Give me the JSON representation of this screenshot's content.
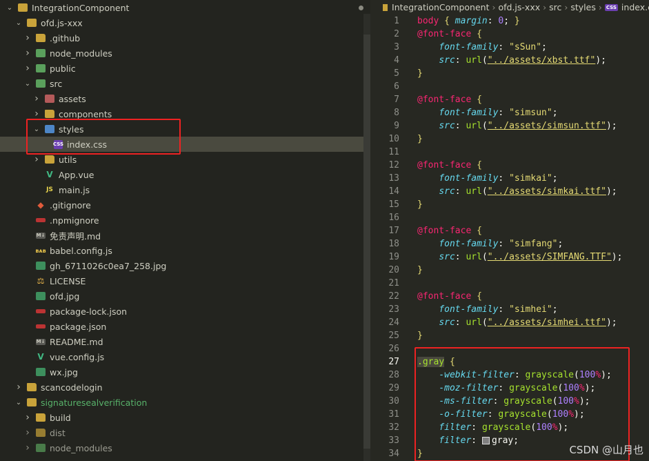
{
  "explorer": {
    "rows": [
      {
        "label": "IntegrationComponent",
        "chev": "v",
        "icon": "folder-open",
        "depth": 0,
        "dot": "#8a8a80"
      },
      {
        "label": "ofd.js-xxx",
        "chev": "v",
        "icon": "folder-open",
        "depth": 1
      },
      {
        "label": ".github",
        "chev": ">",
        "icon": "folder",
        "depth": 2
      },
      {
        "label": "node_modules",
        "chev": ">",
        "icon": "folder-green",
        "depth": 2
      },
      {
        "label": "public",
        "chev": ">",
        "icon": "folder-green",
        "depth": 2
      },
      {
        "label": "src",
        "chev": "v",
        "icon": "folder-green",
        "depth": 2
      },
      {
        "label": "assets",
        "chev": ">",
        "icon": "folder-red",
        "depth": 3
      },
      {
        "label": "components",
        "chev": ">",
        "icon": "folder",
        "depth": 3
      },
      {
        "label": "styles",
        "chev": "v",
        "icon": "folder-blue",
        "depth": 3
      },
      {
        "label": "index.css",
        "chev": "",
        "icon": "css",
        "depth": 4,
        "selected": true
      },
      {
        "label": "utils",
        "chev": ">",
        "icon": "folder",
        "depth": 3
      },
      {
        "label": "App.vue",
        "chev": "",
        "icon": "vue",
        "depth": 3
      },
      {
        "label": "main.js",
        "chev": "",
        "icon": "js",
        "depth": 3
      },
      {
        "label": ".gitignore",
        "chev": "",
        "icon": "git",
        "depth": 2
      },
      {
        "label": ".npmignore",
        "chev": "",
        "icon": "npm",
        "depth": 2
      },
      {
        "label": "免责声明.md",
        "chev": "",
        "icon": "md",
        "depth": 2
      },
      {
        "label": "babel.config.js",
        "chev": "",
        "icon": "babel",
        "depth": 2
      },
      {
        "label": "gh_6711026c0ea7_258.jpg",
        "chev": "",
        "icon": "img",
        "depth": 2
      },
      {
        "label": "LICENSE",
        "chev": "",
        "icon": "license",
        "depth": 2
      },
      {
        "label": "ofd.jpg",
        "chev": "",
        "icon": "img",
        "depth": 2
      },
      {
        "label": "package-lock.json",
        "chev": "",
        "icon": "json",
        "depth": 2
      },
      {
        "label": "package.json",
        "chev": "",
        "icon": "json",
        "depth": 2
      },
      {
        "label": "README.md",
        "chev": "",
        "icon": "md",
        "depth": 2
      },
      {
        "label": "vue.config.js",
        "chev": "",
        "icon": "vueconf",
        "depth": 2
      },
      {
        "label": "wx.jpg",
        "chev": "",
        "icon": "img",
        "depth": 2
      },
      {
        "label": "scancodelogin",
        "chev": ">",
        "icon": "folder",
        "depth": 1
      },
      {
        "label": "signaturesealverification",
        "chev": "v",
        "icon": "folder-open",
        "depth": 1,
        "green": true,
        "dot": "#3aa655"
      },
      {
        "label": "build",
        "chev": ">",
        "icon": "folder",
        "depth": 2
      },
      {
        "label": "dist",
        "chev": ">",
        "icon": "folder",
        "depth": 2,
        "dim": true
      },
      {
        "label": "node_modules",
        "chev": ">",
        "icon": "folder-green",
        "depth": 2,
        "dim": true
      }
    ]
  },
  "editor": {
    "breadcrumb": {
      "folder": "IntegrationComponent",
      "sub": "ofd.js-xxx",
      "src": "src",
      "styles": "styles",
      "file": "index.css",
      "file_icon": "CSS"
    },
    "lines": [
      {
        "n": "1",
        "html": "<span class='t-sel'>body</span> <span class='t-brace'>{</span> <span class='t-prop'>margin</span><span class='t-punc'>:</span> <span class='t-num'>0</span><span class='t-punc'>;</span> <span class='t-brace'>}</span>"
      },
      {
        "n": "2",
        "html": "<span class='t-at'>@font-face</span> <span class='t-brace'>{</span>"
      },
      {
        "n": "3",
        "html": "    <span class='t-prop'>font-family</span><span class='t-punc'>:</span> <span class='t-str'>\"sSun\"</span><span class='t-punc'>;</span>"
      },
      {
        "n": "4",
        "html": "    <span class='t-prop'>src</span><span class='t-punc'>:</span> <span class='t-fn'>url</span><span class='t-punc'>(</span><span class='t-url'>\"../assets/xbst.ttf\"</span><span class='t-punc'>);</span>"
      },
      {
        "n": "5",
        "html": "<span class='t-brace'>}</span>"
      },
      {
        "n": "6",
        "html": ""
      },
      {
        "n": "7",
        "html": "<span class='t-at'>@font-face</span> <span class='t-brace'>{</span>"
      },
      {
        "n": "8",
        "html": "    <span class='t-prop'>font-family</span><span class='t-punc'>:</span> <span class='t-str'>\"simsun\"</span><span class='t-punc'>;</span>"
      },
      {
        "n": "9",
        "html": "    <span class='t-prop'>src</span><span class='t-punc'>:</span> <span class='t-fn'>url</span><span class='t-punc'>(</span><span class='t-url'>\"../assets/simsun.ttf\"</span><span class='t-punc'>);</span>"
      },
      {
        "n": "10",
        "html": "<span class='t-brace'>}</span>"
      },
      {
        "n": "11",
        "html": ""
      },
      {
        "n": "12",
        "html": "<span class='t-at'>@font-face</span> <span class='t-brace'>{</span>"
      },
      {
        "n": "13",
        "html": "    <span class='t-prop'>font-family</span><span class='t-punc'>:</span> <span class='t-str'>\"simkai\"</span><span class='t-punc'>;</span>"
      },
      {
        "n": "14",
        "html": "    <span class='t-prop'>src</span><span class='t-punc'>:</span> <span class='t-fn'>url</span><span class='t-punc'>(</span><span class='t-url'>\"../assets/simkai.ttf\"</span><span class='t-punc'>);</span>"
      },
      {
        "n": "15",
        "html": "<span class='t-brace'>}</span>"
      },
      {
        "n": "16",
        "html": ""
      },
      {
        "n": "17",
        "html": "<span class='t-at'>@font-face</span> <span class='t-brace'>{</span>"
      },
      {
        "n": "18",
        "html": "    <span class='t-prop'>font-family</span><span class='t-punc'>:</span> <span class='t-str'>\"simfang\"</span><span class='t-punc'>;</span>"
      },
      {
        "n": "19",
        "html": "    <span class='t-prop'>src</span><span class='t-punc'>:</span> <span class='t-fn'>url</span><span class='t-punc'>(</span><span class='t-url'>\"../assets/SIMFANG.TTF\"</span><span class='t-punc'>);</span>"
      },
      {
        "n": "20",
        "html": "<span class='t-brace'>}</span>"
      },
      {
        "n": "21",
        "html": ""
      },
      {
        "n": "22",
        "html": "<span class='t-at'>@font-face</span> <span class='t-brace'>{</span>"
      },
      {
        "n": "23",
        "html": "    <span class='t-prop'>font-family</span><span class='t-punc'>:</span> <span class='t-str'>\"simhei\"</span><span class='t-punc'>;</span>"
      },
      {
        "n": "24",
        "html": "    <span class='t-prop'>src</span><span class='t-punc'>:</span> <span class='t-fn'>url</span><span class='t-punc'>(</span><span class='t-url'>\"../assets/simhei.ttf\"</span><span class='t-punc'>);</span>"
      },
      {
        "n": "25",
        "html": "<span class='t-brace'>}</span>"
      },
      {
        "n": "26",
        "html": ""
      },
      {
        "n": "27",
        "html": "<span class='sel-bg'><span class='t-cls'>.gray</span></span> <span class='t-brace'>{</span>",
        "active": true
      },
      {
        "n": "28",
        "html": "    <span class='t-prop'>-webkit-filter</span><span class='t-punc'>:</span> <span class='t-fn'>grayscale</span><span class='t-punc'>(</span><span class='t-num'>100</span><span class='t-pct'>%</span><span class='t-punc'>);</span>"
      },
      {
        "n": "29",
        "html": "    <span class='t-prop'>-moz-filter</span><span class='t-punc'>:</span> <span class='t-fn'>grayscale</span><span class='t-punc'>(</span><span class='t-num'>100</span><span class='t-pct'>%</span><span class='t-punc'>);</span>"
      },
      {
        "n": "30",
        "html": "    <span class='t-prop'>-ms-filter</span><span class='t-punc'>:</span> <span class='t-fn'>grayscale</span><span class='t-punc'>(</span><span class='t-num'>100</span><span class='t-pct'>%</span><span class='t-punc'>);</span>"
      },
      {
        "n": "31",
        "html": "    <span class='t-prop'>-o-filter</span><span class='t-punc'>:</span> <span class='t-fn'>grayscale</span><span class='t-punc'>(</span><span class='t-num'>100</span><span class='t-pct'>%</span><span class='t-punc'>);</span>"
      },
      {
        "n": "32",
        "html": "    <span class='t-prop'>filter</span><span class='t-punc'>:</span> <span class='t-fn'>grayscale</span><span class='t-punc'>(</span><span class='t-num'>100</span><span class='t-pct'>%</span><span class='t-punc'>);</span>"
      },
      {
        "n": "33",
        "html": "    <span class='t-prop'>filter</span><span class='t-punc'>:</span> <span class='gray-chip'></span><span class='t-kw'>gray</span><span class='t-punc'>;</span>"
      },
      {
        "n": "34",
        "html": "<span class='t-brace'>}</span>"
      }
    ]
  },
  "watermark": "CSDN @山月也"
}
